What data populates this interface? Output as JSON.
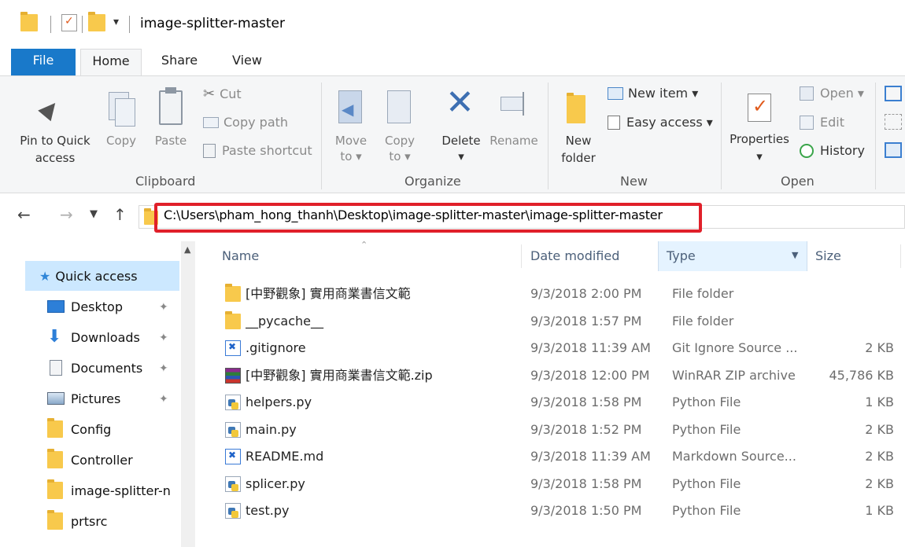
{
  "window": {
    "title": "image-splitter-master"
  },
  "ribbon_tabs": [
    "File",
    "Home",
    "Share",
    "View"
  ],
  "ribbon": {
    "clipboard": {
      "pin_line1": "Pin to Quick",
      "pin_line2": "access",
      "copy": "Copy",
      "paste": "Paste",
      "cut": "Cut",
      "copy_path": "Copy path",
      "paste_shortcut": "Paste shortcut",
      "group": "Clipboard"
    },
    "organize": {
      "move_line1": "Move",
      "move_line2": "to ▾",
      "copy_line1": "Copy",
      "copy_line2": "to ▾",
      "delete": "Delete",
      "delete_arrow": "▾",
      "rename": "Rename",
      "group": "Organize"
    },
    "new": {
      "folder_line1": "New",
      "folder_line2": "folder",
      "new_item": "New item ▾",
      "easy_access": "Easy access ▾",
      "group": "New"
    },
    "open": {
      "properties": "Properties",
      "properties_arrow": "▾",
      "open": "Open ▾",
      "edit": "Edit",
      "history": "History",
      "group": "Open"
    }
  },
  "address": {
    "path": "C:\\Users\\pham_hong_thanh\\Desktop\\image-splitter-master\\image-splitter-master"
  },
  "nav_pane": {
    "quick_access": "Quick access",
    "items": [
      {
        "label": "Desktop",
        "icon": "desktop-icon",
        "pinned": true
      },
      {
        "label": "Downloads",
        "icon": "downloads-icon",
        "pinned": true
      },
      {
        "label": "Documents",
        "icon": "documents-icon",
        "pinned": true
      },
      {
        "label": "Pictures",
        "icon": "pictures-icon",
        "pinned": true
      },
      {
        "label": "Config",
        "icon": "folder-icon",
        "pinned": false
      },
      {
        "label": "Controller",
        "icon": "folder-icon",
        "pinned": false
      },
      {
        "label": "image-splitter-n",
        "icon": "folder-icon",
        "pinned": false
      },
      {
        "label": "prtsrc",
        "icon": "folder-icon",
        "pinned": false
      }
    ]
  },
  "file_list": {
    "columns": [
      "Name",
      "Date modified",
      "Type",
      "Size"
    ],
    "rows": [
      {
        "name": "[中野觀象] 實用商業書信文範",
        "date": "9/3/2018 2:00 PM",
        "type": "File folder",
        "size": "",
        "icon": "folder-icon"
      },
      {
        "name": "__pycache__",
        "date": "9/3/2018 1:57 PM",
        "type": "File folder",
        "size": "",
        "icon": "folder-icon"
      },
      {
        "name": ".gitignore",
        "date": "9/3/2018 11:39 AM",
        "type": "Git Ignore Source ...",
        "size": "2 KB",
        "icon": "vscode-file-icon"
      },
      {
        "name": "[中野觀象] 實用商業書信文範.zip",
        "date": "9/3/2018 12:00 PM",
        "type": "WinRAR ZIP archive",
        "size": "45,786 KB",
        "icon": "winrar-icon"
      },
      {
        "name": "helpers.py",
        "date": "9/3/2018 1:58 PM",
        "type": "Python File",
        "size": "1 KB",
        "icon": "python-file-icon"
      },
      {
        "name": "main.py",
        "date": "9/3/2018 1:52 PM",
        "type": "Python File",
        "size": "2 KB",
        "icon": "python-file-icon"
      },
      {
        "name": "README.md",
        "date": "9/3/2018 11:39 AM",
        "type": "Markdown Source...",
        "size": "2 KB",
        "icon": "vscode-file-icon"
      },
      {
        "name": "splicer.py",
        "date": "9/3/2018 1:58 PM",
        "type": "Python File",
        "size": "2 KB",
        "icon": "python-file-icon"
      },
      {
        "name": "test.py",
        "date": "9/3/2018 1:50 PM",
        "type": "Python File",
        "size": "1 KB",
        "icon": "python-file-icon"
      }
    ]
  },
  "colors": {
    "accent": "#1979ca",
    "highlight_border": "#e0202a",
    "selected_bg": "#cce8ff"
  }
}
